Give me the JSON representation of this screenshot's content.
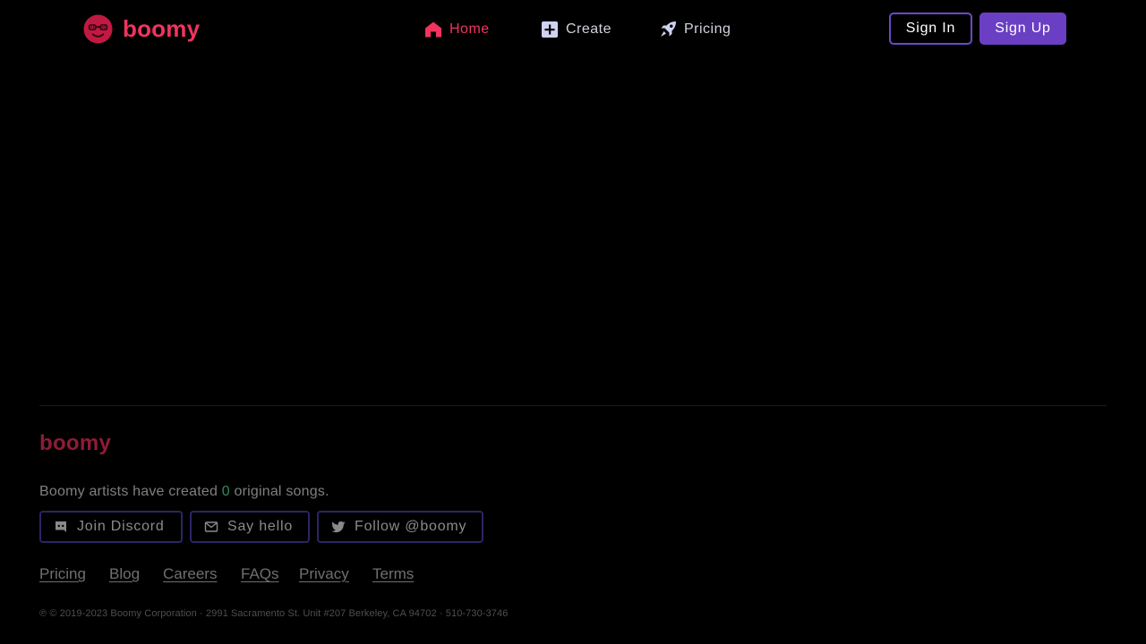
{
  "header": {
    "logo_text": "boomy",
    "nav": [
      {
        "label": "Home",
        "icon": "home-icon",
        "active": true
      },
      {
        "label": "Create",
        "icon": "plus-square-icon",
        "active": false
      },
      {
        "label": "Pricing",
        "icon": "rocket-icon",
        "active": false
      }
    ],
    "sign_in_label": "Sign In",
    "sign_up_label": "Sign Up"
  },
  "footer": {
    "logo_text": "boomy",
    "stats_prefix": "Boomy artists have created",
    "stats_count": "0",
    "stats_suffix": "original songs.",
    "social": [
      {
        "label": "Join Discord",
        "icon": "discord-icon"
      },
      {
        "label": "Say hello",
        "icon": "mail-icon"
      },
      {
        "label": "Follow @boomy",
        "icon": "twitter-icon"
      }
    ],
    "links": [
      "Pricing",
      "Blog",
      "Careers",
      "FAQs",
      "Privacy",
      "Terms"
    ],
    "copyright": "℗ © 2019-2023 Boomy Corporation · 2991 Sacramento St. Unit #207 Berkeley, CA 94702 · 510-730-3746"
  },
  "colors": {
    "brand_red": "#f0345e",
    "brand_purple": "#6a3fc3",
    "stat_green": "#2f8a5e"
  }
}
